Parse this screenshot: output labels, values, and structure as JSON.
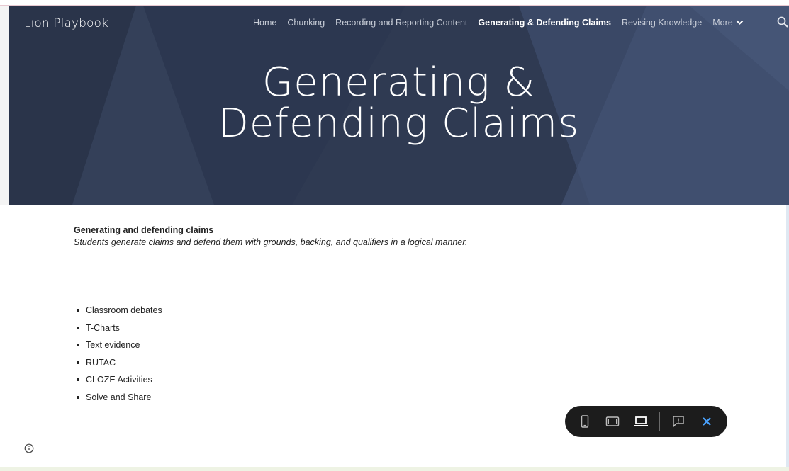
{
  "site": {
    "title": "Lion Playbook"
  },
  "nav": {
    "items": [
      {
        "label": "Home"
      },
      {
        "label": "Chunking"
      },
      {
        "label": "Recording and Reporting Content"
      },
      {
        "label": "Generating & Defending Claims",
        "active": true
      },
      {
        "label": "Revising Knowledge"
      }
    ],
    "more_label": "More",
    "more_icon": "chevron-down-icon",
    "search_icon": "search-icon"
  },
  "hero": {
    "title_line1": "Generating &",
    "title_line2": "Defending Claims"
  },
  "content": {
    "heading": "Generating and defending claims",
    "description": "Students generate claims and defend them with grounds, backing, and qualifiers in a logical manner.",
    "bullets": [
      "Classroom debates",
      "T-Charts",
      "Text evidence",
      "RUTAC",
      "CLOZE Activities",
      "Solve and Share"
    ]
  },
  "preview_toolbar": {
    "buttons": [
      {
        "icon": "phone-preview-icon"
      },
      {
        "icon": "tablet-preview-icon"
      },
      {
        "icon": "laptop-preview-icon",
        "active": true
      },
      {
        "icon": "feedback-icon"
      },
      {
        "icon": "close-icon"
      }
    ]
  },
  "footer": {
    "info_icon": "info-icon"
  },
  "colors": {
    "hero_bg": "#2f3a52",
    "nav_text": "#c9ced8",
    "toolbar_bg": "#1c1c1c",
    "close_accent": "#4aa3ff"
  }
}
